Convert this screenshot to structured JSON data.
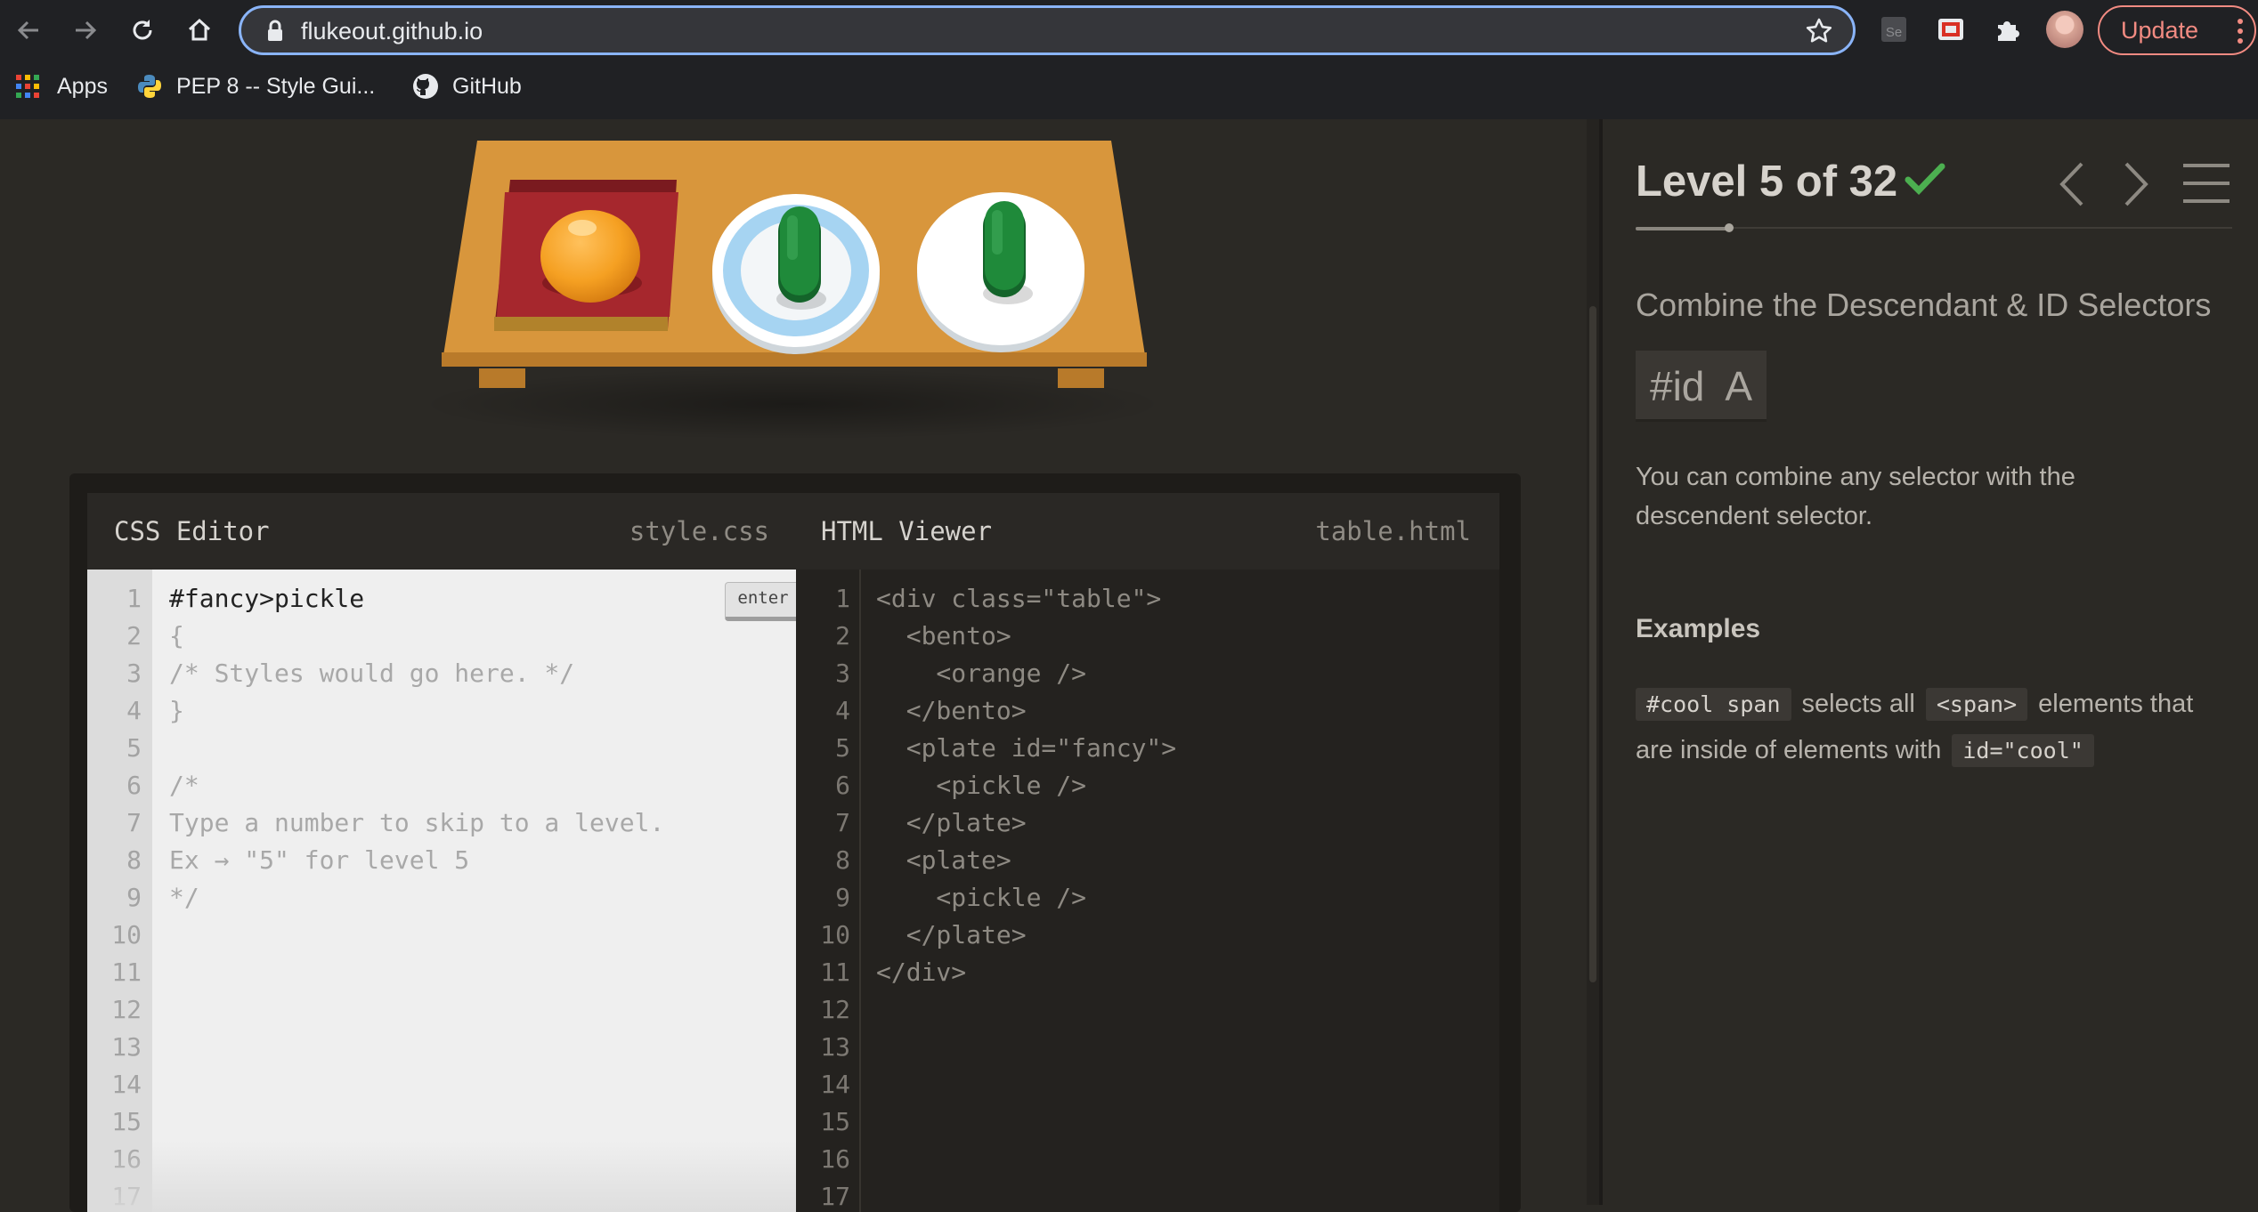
{
  "browser": {
    "url": "flukeout.github.io",
    "update_label": "Update",
    "bookmarks": [
      {
        "label": "Apps",
        "icon": "apps-grid-icon"
      },
      {
        "label": "PEP 8 -- Style Gui...",
        "icon": "python-icon"
      },
      {
        "label": "GitHub",
        "icon": "github-icon"
      }
    ]
  },
  "css_editor": {
    "title": "CSS Editor",
    "filename": "style.css",
    "enter_label": "enter",
    "input_value": "#fancy>pickle",
    "lines": [
      "{",
      "/* Styles would go here. */",
      "}",
      "",
      "/*",
      "Type a number to skip to a level.",
      "Ex → \"5\" for level 5",
      "*/"
    ],
    "line_numbers": [
      "1",
      "2",
      "3",
      "4",
      "5",
      "6",
      "7",
      "8",
      "9",
      "10",
      "11",
      "12",
      "13",
      "14",
      "15",
      "16",
      "17"
    ]
  },
  "html_viewer": {
    "title": "HTML Viewer",
    "filename": "table.html",
    "lines": [
      "<div class=\"table\">",
      "  <bento>",
      "    <orange />",
      "  </bento>",
      "  <plate id=\"fancy\">",
      "    <pickle />",
      "  </plate>",
      "  <plate>",
      "    <pickle />",
      "  </plate>",
      "</div>"
    ],
    "line_numbers": [
      "1",
      "2",
      "3",
      "4",
      "5",
      "6",
      "7",
      "8",
      "9",
      "10",
      "11",
      "12",
      "13",
      "14",
      "15",
      "16",
      "17"
    ]
  },
  "sidebar": {
    "level_title": "Level 5 of 32",
    "completed": true,
    "progress": 0.15625,
    "selector_name": "Combine the Descendant & ID Selectors",
    "syntax": "#id  A",
    "hint": "You can combine any selector with the descendent selector.",
    "examples_title": "Examples",
    "example": {
      "code1": "#cool span",
      "text1": "selects all",
      "code2": "<span>",
      "text2": "elements that",
      "text3": "are inside of elements with",
      "code3": "id=\"cool\""
    }
  },
  "colors": {
    "accent_check": "#4caf50",
    "table_wood": "#d8963c",
    "bento_red": "#a6272d",
    "pickle_green": "#1f8a3a",
    "fancy_plate_ring": "#a6d4f2"
  }
}
